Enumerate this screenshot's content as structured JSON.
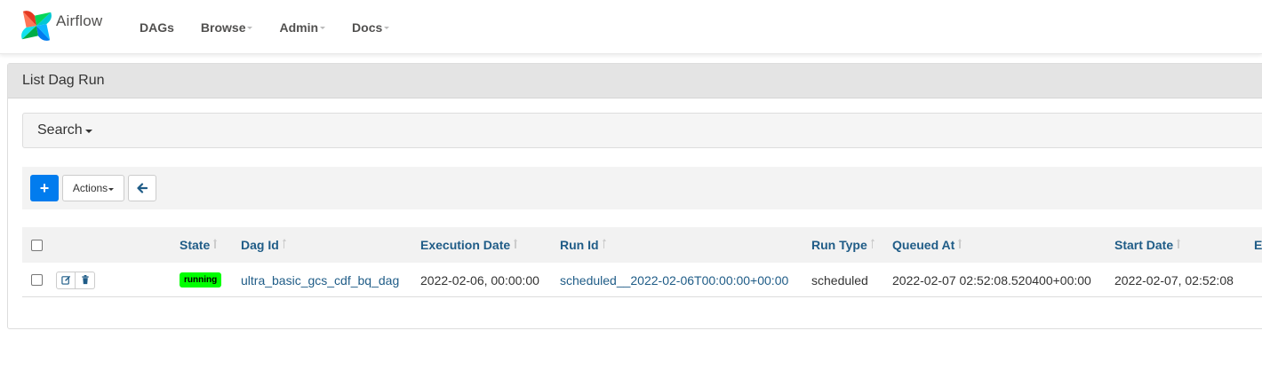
{
  "brand": {
    "name": "Airflow"
  },
  "nav": {
    "items": [
      {
        "label": "DAGs",
        "dropdown": false
      },
      {
        "label": "Browse",
        "dropdown": true
      },
      {
        "label": "Admin",
        "dropdown": true
      },
      {
        "label": "Docs",
        "dropdown": true
      }
    ]
  },
  "panel": {
    "title": "List Dag Run"
  },
  "search": {
    "label": "Search"
  },
  "toolbar": {
    "add_label": "+",
    "actions_label": "Actions"
  },
  "table": {
    "columns": [
      "State",
      "Dag Id",
      "Execution Date",
      "Run Id",
      "Run Type",
      "Queued At",
      "Start Date",
      "E"
    ],
    "rows": [
      {
        "state": "running",
        "dag_id": "ultra_basic_gcs_cdf_bq_dag",
        "execution_date": "2022-02-06, 00:00:00",
        "run_id": "scheduled__2022-02-06T00:00:00+00:00",
        "run_type": "scheduled",
        "queued_at": "2022-02-07 02:52:08.520400+00:00",
        "start_date": "2022-02-07, 02:52:08"
      }
    ]
  },
  "colors": {
    "primary": "#017cee",
    "running": "#00ff00",
    "link": "#1f5c87",
    "heading_bg": "#e4e4e4"
  },
  "icons": [
    "airflow-logo",
    "plus-icon",
    "arrow-left-icon",
    "edit-icon",
    "trash-icon",
    "sort-icon"
  ]
}
